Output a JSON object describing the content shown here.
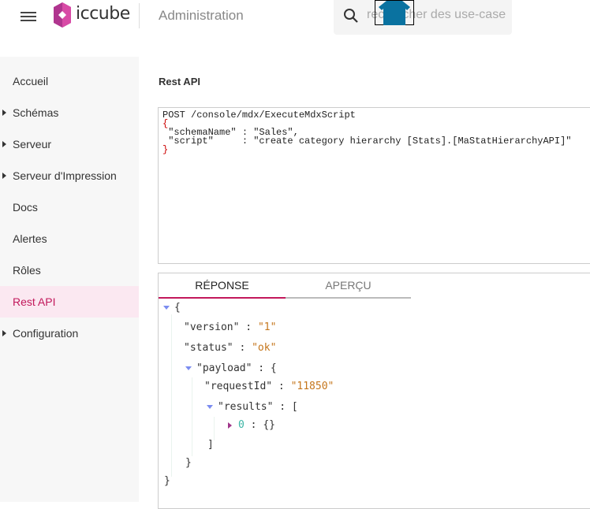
{
  "header": {
    "brand": "iccube",
    "title": "Administration",
    "search_placeholder": "rechercher des use-case",
    "icons": [
      "menu-icon",
      "iccube-logo",
      "search-icon",
      "home-icon"
    ]
  },
  "sidebar": {
    "items": [
      {
        "label": "Accueil",
        "expandable": false,
        "active": false
      },
      {
        "label": "Schémas",
        "expandable": true,
        "active": false
      },
      {
        "label": "Serveur",
        "expandable": true,
        "active": false
      },
      {
        "label": "Serveur d'Impression",
        "expandable": true,
        "active": false
      },
      {
        "label": "Docs",
        "expandable": false,
        "active": false
      },
      {
        "label": "Alertes",
        "expandable": false,
        "active": false
      },
      {
        "label": "Rôles",
        "expandable": false,
        "active": false
      },
      {
        "label": "Rest API",
        "expandable": false,
        "active": true
      },
      {
        "label": "Configuration",
        "expandable": true,
        "active": false
      }
    ]
  },
  "main": {
    "title": "Rest API",
    "request": {
      "line1": "POST /console/mdx/ExecuteMdxScript",
      "open": "{",
      "line3": " \"schemaName\" : \"Sales\",",
      "line4": " \"script\"     : \"create category hierarchy [Stats].[MaStatHierarchyAPI]\"",
      "close": "}"
    },
    "tabs": [
      {
        "label": "RÉPONSE",
        "active": true
      },
      {
        "label": "APERÇU",
        "active": false
      }
    ],
    "response": {
      "version_key": "\"version\"",
      "version_val": "\"1\"",
      "status_key": "\"status\"",
      "status_val": "\"ok\"",
      "payload_key": "\"payload\"",
      "requestId_key": "\"requestId\"",
      "requestId_val": "\"11850\"",
      "results_key": "\"results\"",
      "item_index": "0",
      "item_val": "{}"
    }
  },
  "colors": {
    "accent": "#c2185b",
    "active_bg": "#fbe8f1",
    "string": "#c5761c",
    "number": "#3bb5a5",
    "toggle": "#7b8cf0"
  }
}
